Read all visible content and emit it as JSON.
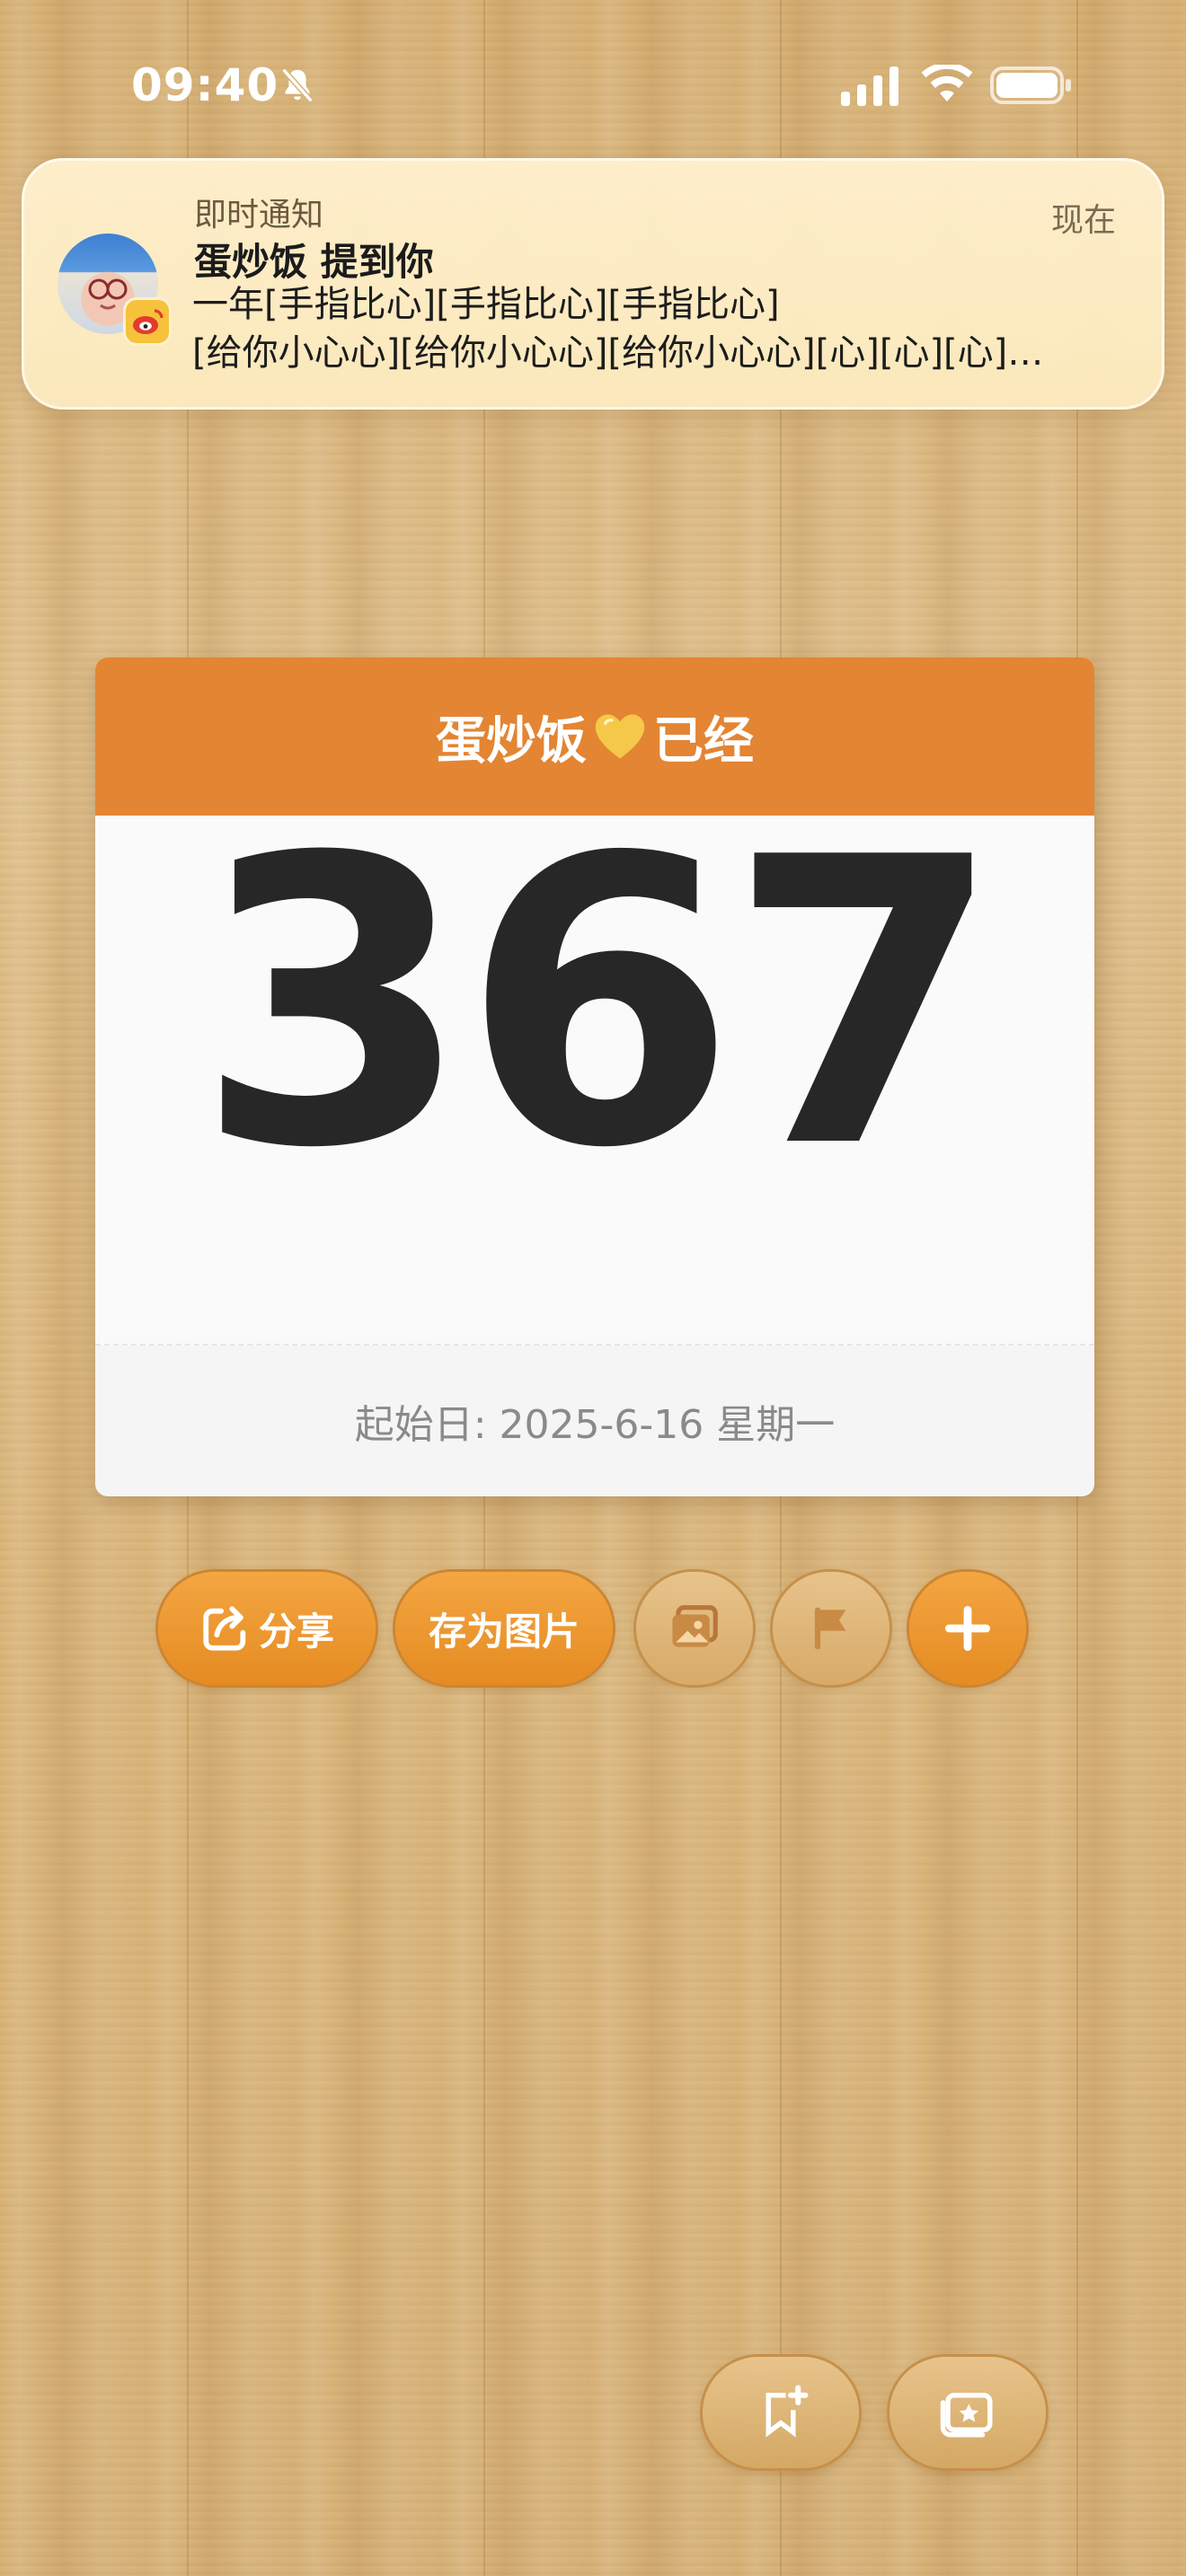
{
  "status_bar": {
    "time": "09:40",
    "icons": [
      "bell-slash-icon",
      "cellular-signal-icon",
      "wifi-icon",
      "battery-icon"
    ]
  },
  "notification": {
    "app_name": "即时通知",
    "time": "现在",
    "title": "蛋炒饭 提到你",
    "body_line1": "一年[手指比心][手指比心][手指比心]",
    "body_line2": "[给你小心心][给你小心心][给你小心心][心][心][心]…",
    "avatar_icon": "user-avatar",
    "badge_icon": "weibo-icon"
  },
  "counter_card": {
    "header_name": "蛋炒饭",
    "header_suffix": "已经",
    "heart_icon": "yellow-heart-icon",
    "days": "367",
    "start_date": "起始日: 2025-6-16 星期一"
  },
  "actions": {
    "share_label": "分享",
    "save_image_label": "存为图片",
    "icons": [
      "share-icon",
      "photo-icon",
      "flag-icon",
      "plus-icon"
    ]
  },
  "bottom_bar": {
    "icons": [
      "bookmark-add-icon",
      "photo-stack-icon"
    ]
  },
  "colors": {
    "accent": "#e38533",
    "button_orange": "#ee9a35",
    "number": "#272727",
    "wood": "#dcb87d"
  }
}
